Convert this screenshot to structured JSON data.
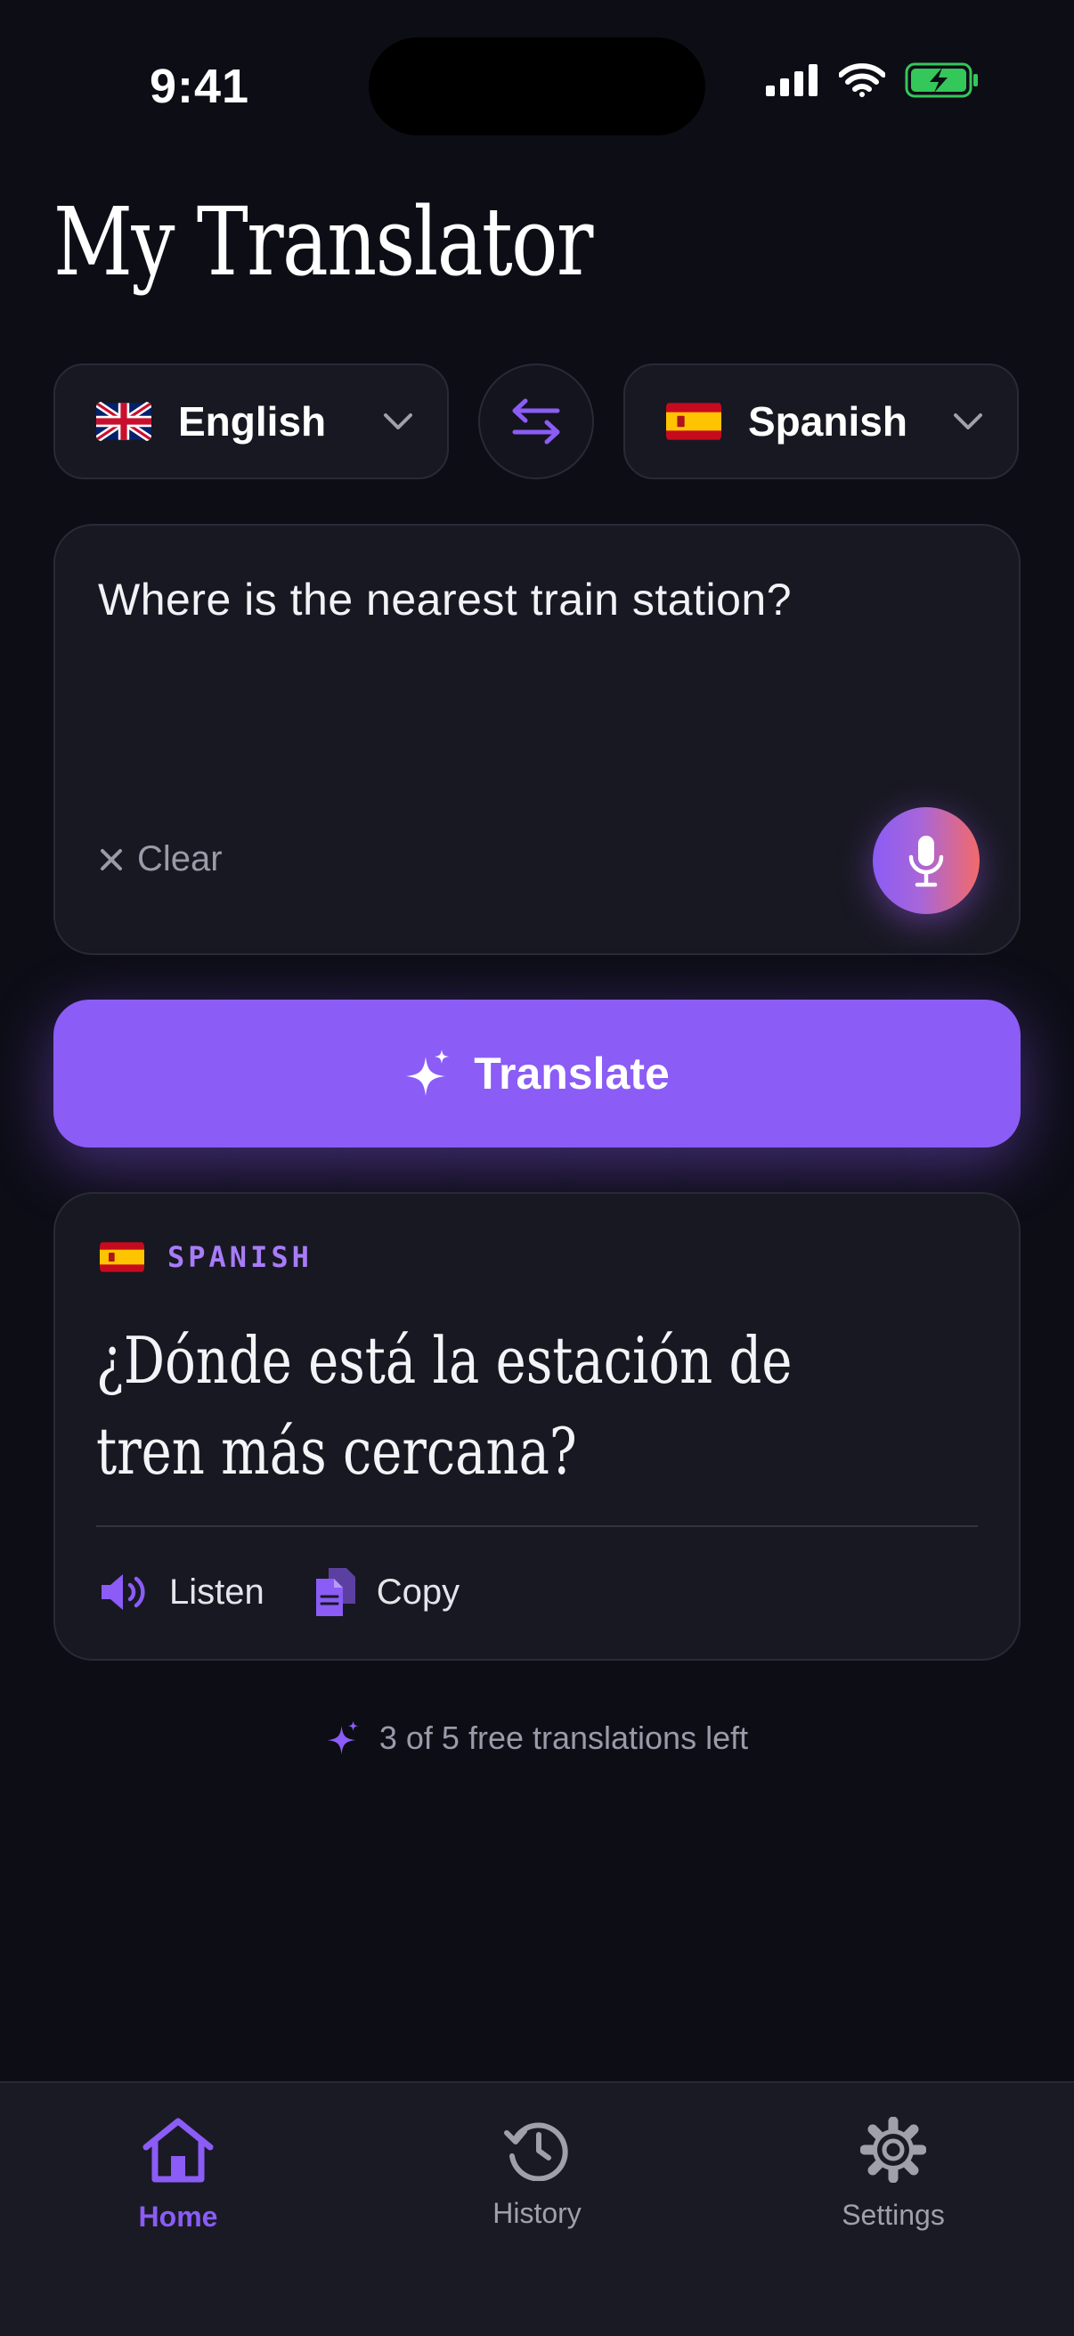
{
  "status_bar": {
    "time": "9:41"
  },
  "app": {
    "title": "My Translator"
  },
  "languages": {
    "source": {
      "label": "English",
      "flag": "uk-flag-icon"
    },
    "target": {
      "label": "Spanish",
      "flag": "spain-flag-icon"
    }
  },
  "input": {
    "text": "Where is the nearest train station?",
    "clear_label": "Clear"
  },
  "translate_button": {
    "label": "Translate"
  },
  "result": {
    "language_label": "SPANISH",
    "text": "¿Dónde está la estación de tren más cercana?",
    "listen_label": "Listen",
    "copy_label": "Copy"
  },
  "quota": {
    "text": "3 of 5 free translations left",
    "used": 3,
    "total": 5
  },
  "tabs": [
    {
      "label": "Home",
      "icon": "home-icon",
      "active": true
    },
    {
      "label": "History",
      "icon": "history-icon",
      "active": false
    },
    {
      "label": "Settings",
      "icon": "gear-icon",
      "active": false
    }
  ],
  "colors": {
    "background": "#0d0d16",
    "card": "#181822",
    "accent": "#8b5cf6",
    "accent_light": "#a87cf8",
    "mic_gradient_end": "#f36a6a",
    "battery": "#34c759"
  }
}
